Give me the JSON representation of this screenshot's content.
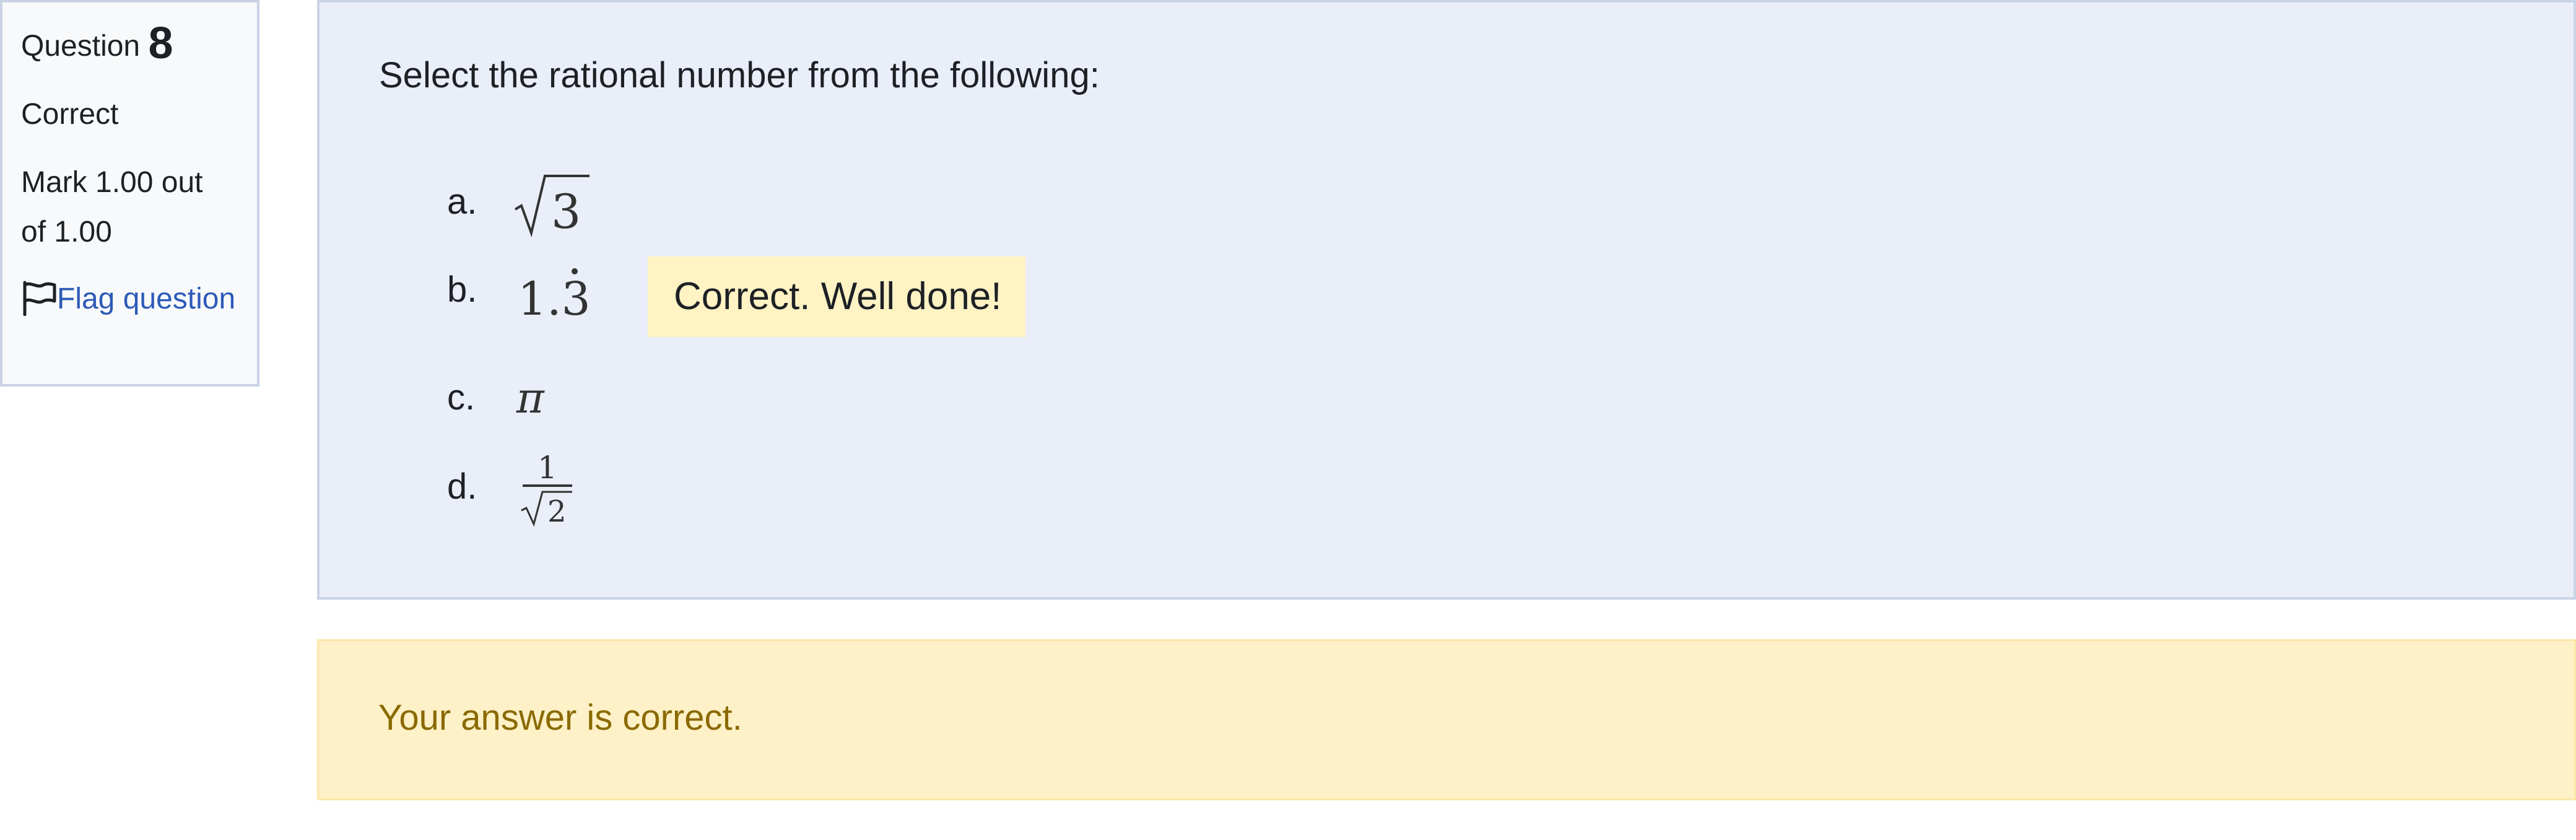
{
  "info": {
    "question_label": "Question",
    "question_number": "8",
    "state": "Correct",
    "grade": "Mark 1.00 out of 1.00",
    "flag_label": "Flag question"
  },
  "question": {
    "text": "Select the rational number from the following:",
    "answers": [
      {
        "letter": "a.",
        "math": "√3",
        "selected": false
      },
      {
        "letter": "b.",
        "math": "1.3̇",
        "selected": true,
        "correct": true
      },
      {
        "letter": "c.",
        "math": "π",
        "selected": false
      },
      {
        "letter": "d.",
        "math": "1/√2",
        "selected": false
      }
    ],
    "specific_feedback": "Correct. Well done!"
  },
  "outcome": {
    "text": "Your answer is correct."
  },
  "colors": {
    "correct_green": "#1f9d3a",
    "link_blue": "#2d5ab8",
    "feedback_bg": "#fff3c4",
    "formulation_bg": "#e9eef8"
  },
  "icons": {
    "flag": "flag-icon",
    "correct": "check-circle-icon"
  }
}
